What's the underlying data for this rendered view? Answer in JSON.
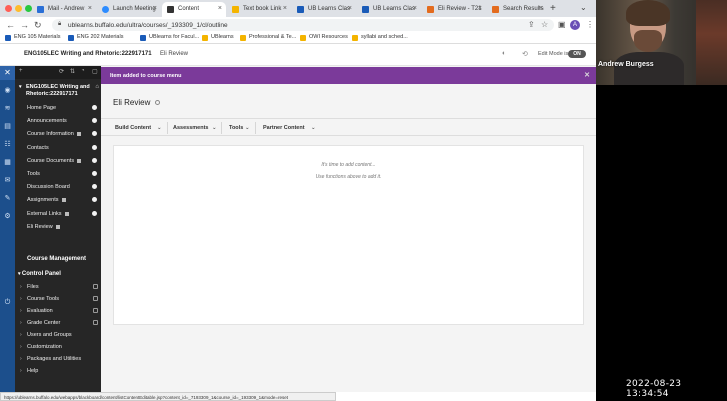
{
  "browser": {
    "tabs": [
      {
        "label": "Mail - Andrew"
      },
      {
        "label": "Launch Meeting"
      },
      {
        "label": "Content"
      },
      {
        "label": "Text book Link"
      },
      {
        "label": "UB Learns Clas"
      },
      {
        "label": "UB Learns Clas"
      },
      {
        "label": "Eli Review - T21"
      },
      {
        "label": "Search Results"
      }
    ],
    "url": "ublearns.buffalo.edu/ultra/courses/_193309_1/cl/outline",
    "profile_initial": "A",
    "bookmarks": [
      {
        "label": "ENG 105 Materials"
      },
      {
        "label": "ENG 202 Materials"
      },
      {
        "label": "UBlearns for Facul..."
      },
      {
        "label": "UBlearns"
      },
      {
        "label": "Professional & Te..."
      },
      {
        "label": "OWI Resources"
      },
      {
        "label": "syllabi and sched..."
      }
    ]
  },
  "course_header": {
    "title": "ENG105LEC Writing and Rhetoric:222917171",
    "page": "Eli Review",
    "edit_mode_label": "Edit Mode is:",
    "edit_mode_state": "ON"
  },
  "course_menu": {
    "course_title": "ENG105LEC Writing and Rhetoric:222917171",
    "items": [
      {
        "label": "Home Page"
      },
      {
        "label": "Announcements"
      },
      {
        "label": "Course Information"
      },
      {
        "label": "Contacts"
      },
      {
        "label": "Course Documents"
      },
      {
        "label": "Tools"
      },
      {
        "label": "Discussion Board"
      },
      {
        "label": "Assignments"
      },
      {
        "label": "External Links"
      },
      {
        "label": "Eli Review"
      }
    ],
    "course_management_title": "Course Management",
    "control_panel_title": "Control Panel",
    "control_panel_items": [
      {
        "label": "Files"
      },
      {
        "label": "Course Tools"
      },
      {
        "label": "Evaluation"
      },
      {
        "label": "Grade Center"
      },
      {
        "label": "Users and Groups"
      },
      {
        "label": "Customization"
      },
      {
        "label": "Packages and Utilities"
      },
      {
        "label": "Help"
      }
    ]
  },
  "main": {
    "banner": "Item added to course menu",
    "page_title": "Eli Review",
    "action_bar": [
      {
        "label": "Build Content"
      },
      {
        "label": "Assessments"
      },
      {
        "label": "Tools"
      },
      {
        "label": "Partner Content"
      }
    ],
    "empty_line1": "It's time to add content...",
    "empty_line2": "Use functions above to add it."
  },
  "status_url": "https://ublearns.buffalo.edu/webapps/blackboard/content/listContentEditable.jsp?content_id=_7193309_1&course_id=_193309_1&mode=reset",
  "webcam": {
    "name": "Andrew Burgess"
  },
  "timestamp": "2022-08-23  13:34:54",
  "colors": {
    "banner": "#7b3a9a",
    "rail": "#1c4f8c",
    "menu_bg": "#262626"
  }
}
